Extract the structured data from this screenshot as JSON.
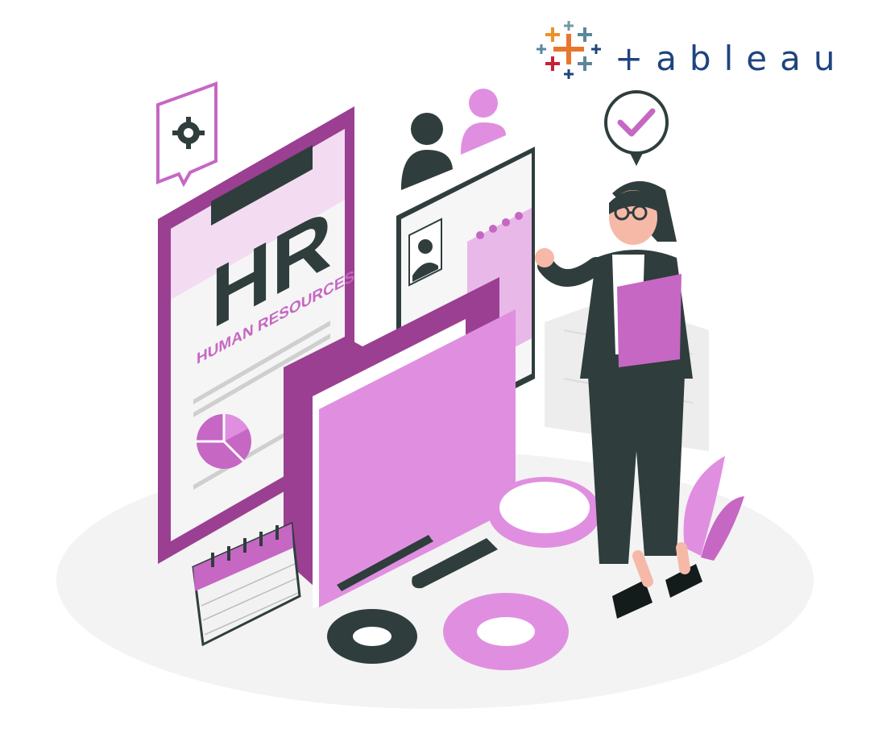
{
  "brand": {
    "wordmark": "+ableau",
    "colors": {
      "primary": "#1f447e",
      "cross_orange": "#e8762d",
      "cross_red": "#c72037",
      "cross_blue": "#5b879b",
      "cross_teal": "#59879b",
      "cross_yellow": "#eb9129"
    }
  },
  "clipboard": {
    "title": "HR",
    "subtitle": "HUMAN RESOURCES"
  },
  "icons": [
    "gear-icon",
    "user-icon",
    "check-icon",
    "pie-chart-icon",
    "calendar-icon",
    "magnifier-icon",
    "folder-icon",
    "resume-card-icon",
    "pencil-icon"
  ],
  "colors": {
    "purple_dark": "#9b3f92",
    "purple_mid": "#c667c4",
    "purple_light": "#e08fe0",
    "purple_pale": "#f3dcf1",
    "ink": "#2f3d3d",
    "paper": "#f7f7f7"
  }
}
